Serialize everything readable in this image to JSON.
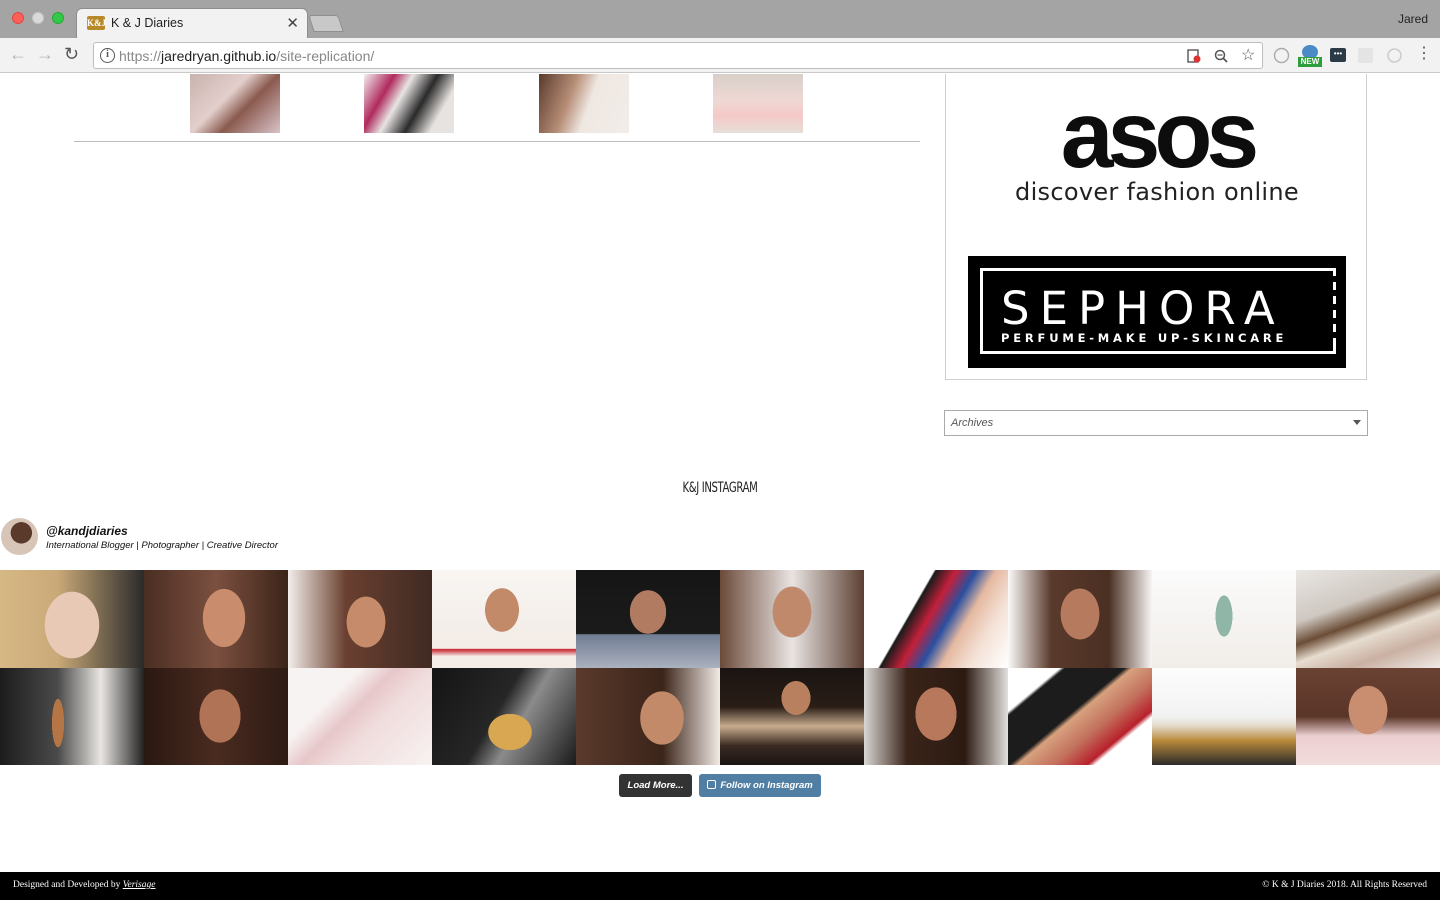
{
  "browser": {
    "tab_title": "K & J Diaries",
    "tab_favicon": "K&J",
    "tab_close": "✕",
    "profile_name": "Jared",
    "url_prefix": "https://",
    "url_host": "jaredryan.github.io",
    "url_path": "/site-replication/",
    "icons": [
      "back-arrow-icon",
      "forward-arrow-icon",
      "reload-icon",
      "info-icon",
      "blocked-popup-icon",
      "zoom-icon",
      "bookmark-star-icon",
      "menu-kebab-icon"
    ],
    "extension_badge": "NEW"
  },
  "sidebar": {
    "asos_word": "asos",
    "asos_tagline": "discover fashion online",
    "sephora_word": "SEPHORA",
    "sephora_tagline": "PERFUME-MAKE UP-SKINCARE",
    "archives_label": "Archives"
  },
  "instagram": {
    "section_title": "K&J INSTAGRAM",
    "handle": "@kandjdiaries",
    "bio": "International Blogger | Photographer | Creative Director",
    "load_more": "Load More...",
    "follow": "Follow on Instagram"
  },
  "footer": {
    "credit_prefix": "Designed and Developed by",
    "credit_link": "Verisage",
    "copyright": "© K & J Diaries 2018. All Rights Reserved"
  },
  "colors": {
    "follow_button": "#517fa4",
    "load_button": "#333333",
    "footer_bg": "#000000"
  }
}
